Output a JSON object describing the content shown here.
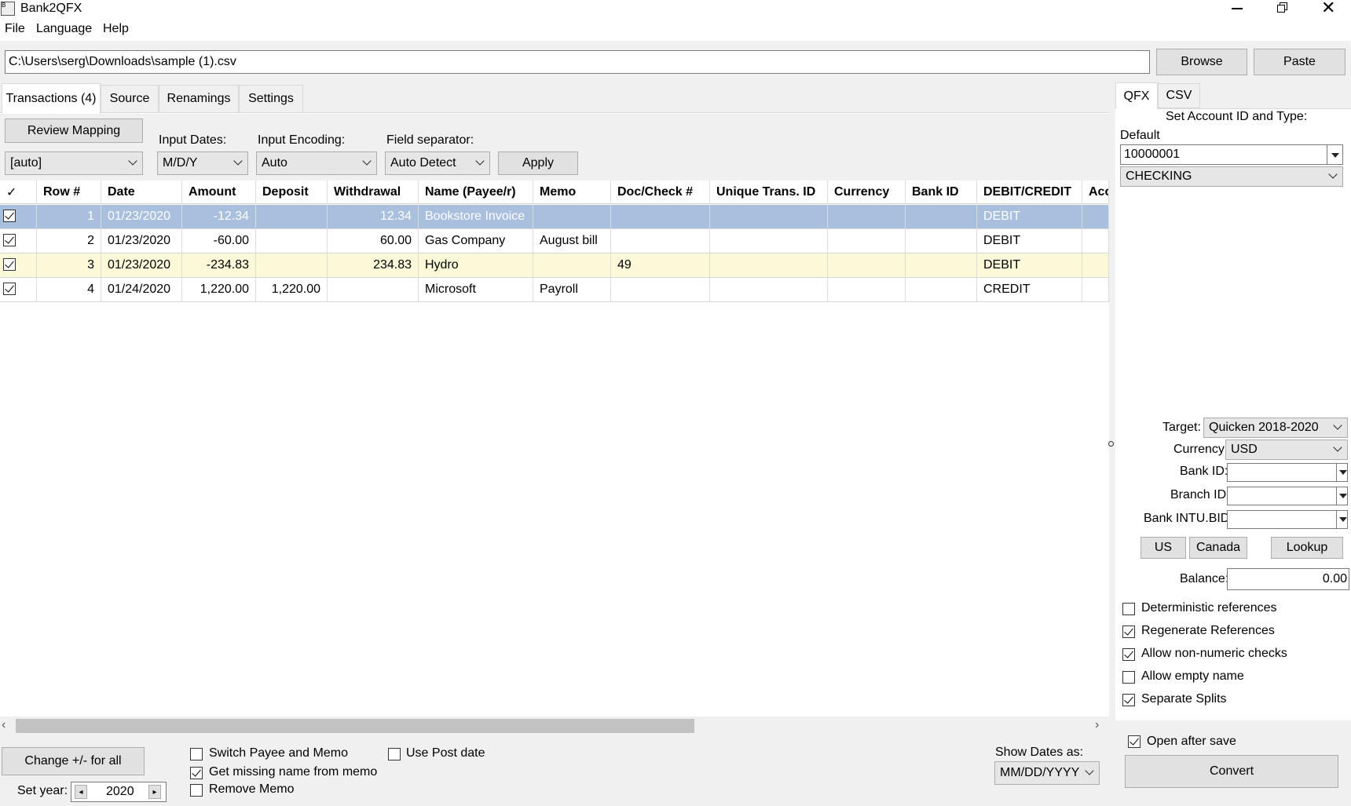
{
  "window": {
    "title": "Bank2QFX"
  },
  "menu": [
    "File",
    "Language",
    "Help"
  ],
  "path": {
    "value": "C:\\Users\\serg\\Downloads\\sample (1).csv",
    "browse": "Browse",
    "paste": "Paste"
  },
  "tabs": [
    "Transactions (4)",
    "Source",
    "Renamings",
    "Settings"
  ],
  "toolbar": {
    "review_mapping": "Review Mapping",
    "mapping_value": "[auto]",
    "input_dates_label": "Input Dates:",
    "input_dates_value": "M/D/Y",
    "input_encoding_label": "Input Encoding:",
    "input_encoding_value": "Auto",
    "field_separator_label": "Field separator:",
    "field_separator_value": "Auto Detect",
    "apply": "Apply"
  },
  "grid": {
    "columns": [
      "✓",
      "Row #",
      "Date",
      "Amount",
      "Deposit",
      "Withdrawal",
      "Name (Payee/r)",
      "Memo",
      "Doc/Check #",
      "Unique Trans. ID",
      "Currency",
      "Bank ID",
      "DEBIT/CREDIT",
      "Acc"
    ],
    "rows": [
      {
        "checked": true,
        "row": "1",
        "date": "01/23/2020",
        "amount": "-12.34",
        "deposit": "",
        "withdrawal": "12.34",
        "name": "Bookstore Invoice",
        "memo": "",
        "doc": "",
        "uid": "",
        "currency": "",
        "bankid": "",
        "dc": "DEBIT"
      },
      {
        "checked": true,
        "row": "2",
        "date": "01/23/2020",
        "amount": "-60.00",
        "deposit": "",
        "withdrawal": "60.00",
        "name": "Gas Company",
        "memo": "August bill",
        "doc": "",
        "uid": "",
        "currency": "",
        "bankid": "",
        "dc": "DEBIT"
      },
      {
        "checked": true,
        "row": "3",
        "date": "01/23/2020",
        "amount": "-234.83",
        "deposit": "",
        "withdrawal": "234.83",
        "name": "Hydro",
        "memo": "",
        "doc": "49",
        "uid": "",
        "currency": "",
        "bankid": "",
        "dc": "DEBIT"
      },
      {
        "checked": true,
        "row": "4",
        "date": "01/24/2020",
        "amount": "1,220.00",
        "deposit": "1,220.00",
        "withdrawal": "",
        "name": "Microsoft",
        "memo": "Payroll",
        "doc": "",
        "uid": "",
        "currency": "",
        "bankid": "",
        "dc": "CREDIT"
      }
    ]
  },
  "bottom": {
    "change_sign": "Change +/- for all",
    "set_year_label": "Set year:",
    "year": "2020",
    "switch_payee_memo": "Switch Payee and Memo",
    "get_missing_name": "Get missing name from memo",
    "remove_memo": "Remove Memo",
    "use_post_date": "Use Post date",
    "show_dates_label": "Show Dates as:",
    "show_dates_value": "MM/DD/YYYY"
  },
  "right": {
    "tabs": [
      "QFX",
      "CSV"
    ],
    "set_account_label": "Set Account ID and Type:",
    "default_label": "Default",
    "account_id": "10000001",
    "account_type": "CHECKING",
    "target_label": "Target:",
    "target_value": "Quicken 2018-2020",
    "currency_label": "Currency:",
    "currency_value": "USD",
    "bank_id_label": "Bank ID:",
    "branch_id_label": "Branch ID:",
    "intu_bid_label": "Bank INTU.BID:",
    "us": "US",
    "canada": "Canada",
    "lookup": "Lookup",
    "balance_label": "Balance:",
    "balance_value": "0.00",
    "options": [
      {
        "label": "Deterministic references",
        "checked": false
      },
      {
        "label": "Regenerate References",
        "checked": true
      },
      {
        "label": "Allow non-numeric checks",
        "checked": true
      },
      {
        "label": "Allow empty name",
        "checked": false
      },
      {
        "label": "Separate Splits",
        "checked": true
      }
    ],
    "open_after_save": "Open after save",
    "convert": "Convert"
  }
}
